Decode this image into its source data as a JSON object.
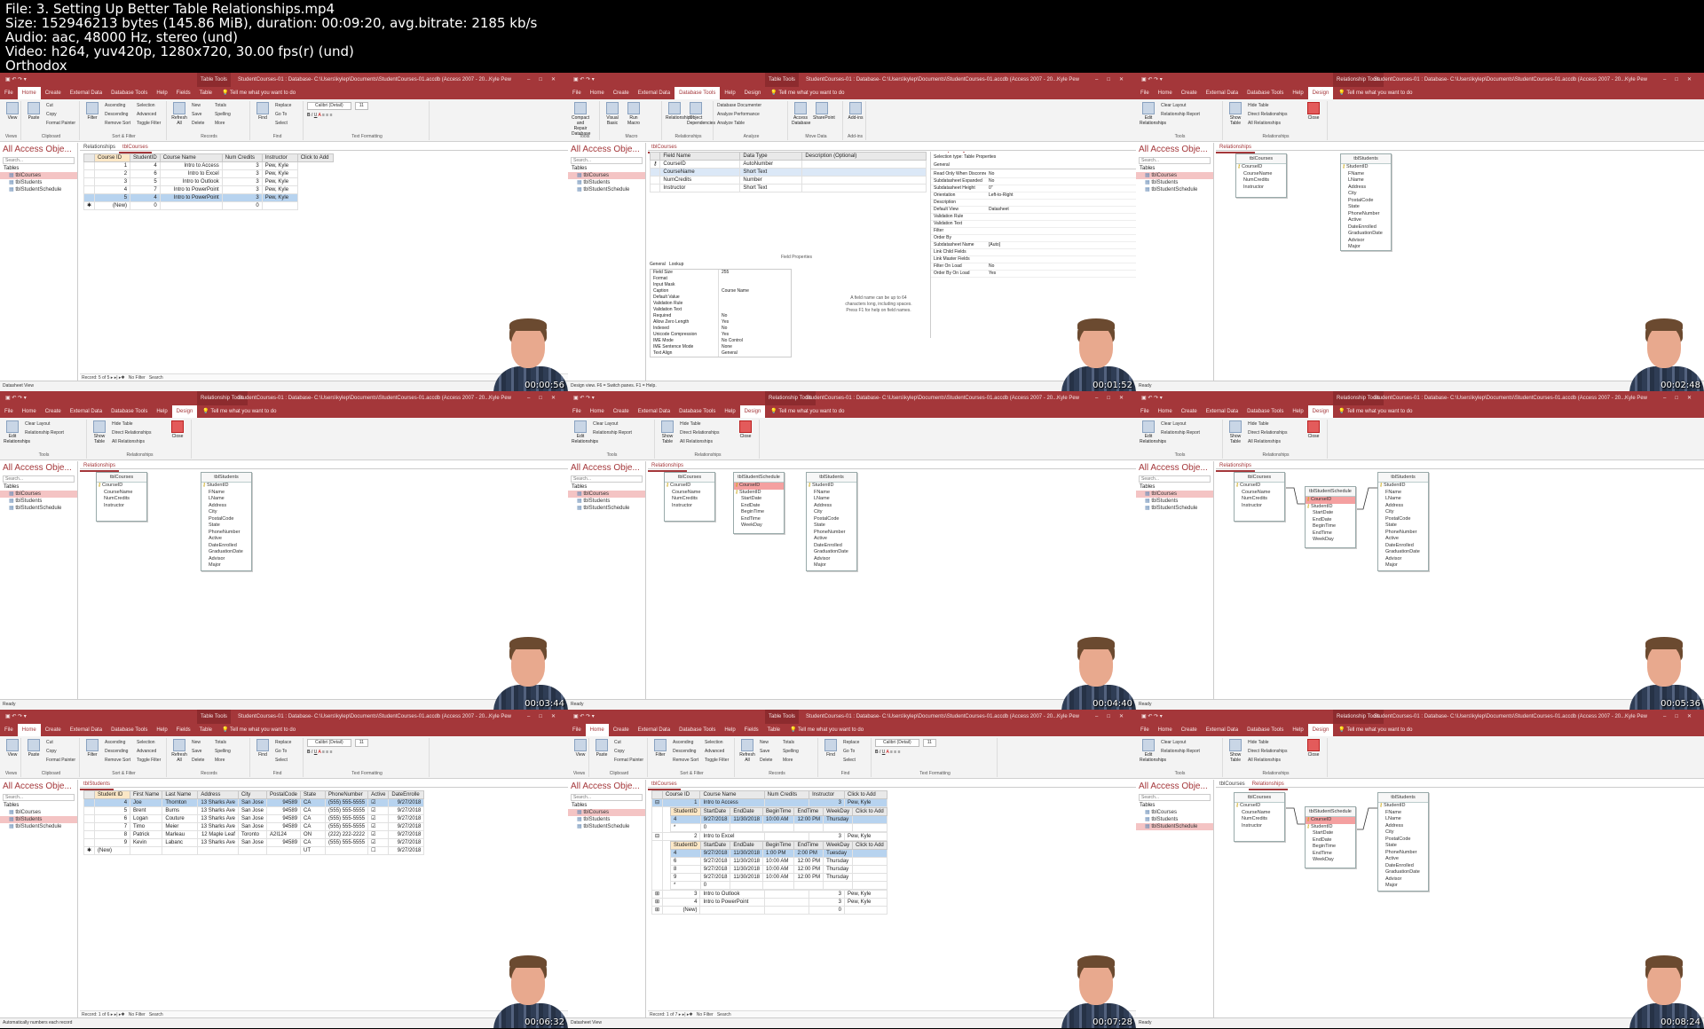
{
  "header": {
    "file": "File: 3. Setting Up Better Table Relationships.mp4",
    "size": "Size: 152946213 bytes (145.86 MiB), duration: 00:09:20, avg.bitrate: 2185 kb/s",
    "audio": "Audio: aac, 48000 Hz, stereo (und)",
    "video": "Video: h264, yuv420p, 1280x720, 30.00 fps(r) (und)",
    "brand": "Orthodox"
  },
  "common": {
    "file_tab": "File",
    "home_tab": "Home",
    "create_tab": "Create",
    "external_tab": "External Data",
    "dbtools_tab": "Database Tools",
    "help_tab": "Help",
    "fields_tab": "Fields",
    "table_tab": "Table",
    "design_tab": "Design",
    "tell_me": "Tell me what you want to do",
    "user": "Kyle Pew",
    "doc_title": "StudentCourses-01 : Database- C:\\Users\\kylep\\Documents\\StudentCourses-01.accdb (Access 2007 - 20...",
    "table_tools": "Table Tools",
    "rel_tools": "Relationship Tools",
    "nav_header": "All Access Obje...",
    "nav_search": "Search...",
    "nav_tables": "Tables",
    "t_courses": "tblCourses",
    "t_students": "tblStudents",
    "t_schedule": "tblStudentSchedule",
    "rel_tab": "Relationships",
    "status_ready": "Ready",
    "home_ribbon": {
      "views": "Views",
      "view": "View",
      "clipboard": "Clipboard",
      "paste": "Paste",
      "cut": "Cut",
      "copy": "Copy",
      "painter": "Format Painter",
      "sortfilter": "Sort & Filter",
      "filter": "Filter",
      "asc": "Ascending",
      "desc": "Descending",
      "remove": "Remove Sort",
      "selection": "Selection",
      "advanced": "Advanced",
      "toggle": "Toggle Filter",
      "records": "Records",
      "refresh": "Refresh All",
      "new": "New",
      "save": "Save",
      "delete": "Delete",
      "totals": "Totals",
      "spelling": "Spelling",
      "more": "More",
      "find_g": "Find",
      "find": "Find",
      "replace": "Replace",
      "goto": "Go To",
      "select": "Select",
      "textfmt": "Text Formatting",
      "font": "Calibri (Detail)",
      "fsize": "11"
    },
    "rel_ribbon": {
      "edit": "Edit Relationships",
      "clear": "Clear Layout",
      "report": "Relationship Report",
      "tools": "Tools",
      "show": "Show Table",
      "hide": "Hide Table",
      "direct": "Direct Relationships",
      "all": "All Relationships",
      "close": "Close",
      "relgroup": "Relationships"
    },
    "db_ribbon": {
      "compact": "Compact and Repair Database",
      "visual": "Visual Basic",
      "macro": "Run Macro",
      "rels": "Relationships",
      "objdep": "Object Dependencies",
      "documenter": "Database Documenter",
      "analyze_perf": "Analyze Performance",
      "analyze_table": "Analyze Table",
      "access": "Access Database",
      "sharepoint": "SharePoint",
      "addins": "Add-ins",
      "tools": "Tools",
      "macro_g": "Macro",
      "rel_g": "Relationships",
      "analyze": "Analyze",
      "move": "Move Data",
      "addins_g": "Add-ins"
    }
  },
  "courses_fields": [
    "CourseID",
    "CourseName",
    "NumCredits",
    "Instructor"
  ],
  "students_fields": [
    "StudentID",
    "FName",
    "LName",
    "Address",
    "City",
    "PostalCode",
    "State",
    "PhoneNumber",
    "Active",
    "DateEnrolled",
    "GraduationDate",
    "Advisor",
    "Major"
  ],
  "schedule_fields": [
    "CourseID",
    "StudentID",
    "StartDate",
    "EndDate",
    "BeginTime",
    "EndTime",
    "WeekDay"
  ],
  "frames": [
    {
      "ts": "00:00:56",
      "status": "Datasheet View",
      "cols": [
        "Course ID",
        "StudentID",
        "Course Name",
        "Num Credits",
        "Instructor",
        "Click to Add"
      ],
      "rows": [
        [
          "1",
          "4",
          "Intro to Access",
          "3",
          "Pew, Kyle"
        ],
        [
          "2",
          "6",
          "Intro to Excel",
          "3",
          "Pew, Kyle"
        ],
        [
          "3",
          "5",
          "Intro to Outlook",
          "3",
          "Pew, Kyle"
        ],
        [
          "4",
          "7",
          "Intro to PowerPoint",
          "3",
          "Pew, Kyle"
        ],
        [
          "5",
          "4",
          "Intro to PowerPoint",
          "3",
          "Pew, Kyle"
        ],
        [
          "(New)",
          "0",
          "",
          "0",
          ""
        ]
      ],
      "record": "Record: 5 of 5",
      "nofilter": "No Filter",
      "search": "Search"
    },
    {
      "ts": "00:01:52",
      "status": "Design view. F6 = Switch panes. F1 = Help.",
      "design_cols": [
        "Field Name",
        "Data Type",
        "Description (Optional)"
      ],
      "design_rows": [
        [
          "CourseID",
          "AutoNumber"
        ],
        [
          "CourseName",
          "Short Text"
        ],
        [
          "NumCredits",
          "Number"
        ],
        [
          "Instructor",
          "Short Text"
        ]
      ],
      "field_props": "Field Properties",
      "gen_tab": "General",
      "lookup_tab": "Lookup",
      "props": [
        [
          "Field Size",
          "255"
        ],
        [
          "Format",
          ""
        ],
        [
          "Input Mask",
          ""
        ],
        [
          "Caption",
          "Course Name"
        ],
        [
          "Default Value",
          ""
        ],
        [
          "Validation Rule",
          ""
        ],
        [
          "Validation Text",
          ""
        ],
        [
          "Required",
          "No"
        ],
        [
          "Allow Zero Length",
          "Yes"
        ],
        [
          "Indexed",
          "No"
        ],
        [
          "Unicode Compression",
          "Yes"
        ],
        [
          "IME Mode",
          "No Control"
        ],
        [
          "IME Sentence Mode",
          "None"
        ],
        [
          "Text Align",
          "General"
        ]
      ],
      "help": "A field name can be up to 64 characters long, including spaces. Press F1 for help on field names.",
      "ps_title": "Property Sheet",
      "ps_sel": "Selection type: Table Properties",
      "ps_gen": "General",
      "ps_rows": [
        [
          "Read Only When Disconnect",
          "No"
        ],
        [
          "Subdatasheet Expanded",
          "No"
        ],
        [
          "Subdatasheet Height",
          "0\""
        ],
        [
          "Orientation",
          "Left-to-Right"
        ],
        [
          "Description",
          ""
        ],
        [
          "Default View",
          "Datasheet"
        ],
        [
          "Validation Rule",
          ""
        ],
        [
          "Validation Text",
          ""
        ],
        [
          "Filter",
          ""
        ],
        [
          "Order By",
          ""
        ],
        [
          "Subdatasheet Name",
          "[Auto]"
        ],
        [
          "Link Child Fields",
          ""
        ],
        [
          "Link Master Fields",
          ""
        ],
        [
          "Filter On Load",
          "No"
        ],
        [
          "Order By On Load",
          "Yes"
        ]
      ]
    },
    {
      "ts": "00:02:48"
    },
    {
      "ts": "00:03:44"
    },
    {
      "ts": "00:04:40"
    },
    {
      "ts": "00:05:36"
    },
    {
      "ts": "00:06:32",
      "status": "Automatically numbers each record",
      "cols": [
        "Student ID",
        "First Name",
        "Last Name",
        "Address",
        "City",
        "PostalCode",
        "State",
        "PhoneNumber",
        "Active",
        "DateEnrolle"
      ],
      "rows": [
        [
          "4",
          "Joe",
          "Thornton",
          "13 Sharks Ave",
          "San Jose",
          "94589",
          "CA",
          "(555) 555-5555",
          "☑",
          "9/27/2018"
        ],
        [
          "5",
          "Brent",
          "Burns",
          "13 Sharks Ave",
          "San Jose",
          "94589",
          "CA",
          "(555) 555-5555",
          "☑",
          "9/27/2018"
        ],
        [
          "6",
          "Logan",
          "Couture",
          "13 Sharks Ave",
          "San Jose",
          "94589",
          "CA",
          "(555) 555-5555",
          "☑",
          "9/27/2018"
        ],
        [
          "7",
          "Timo",
          "Meier",
          "13 Sharks Ave",
          "San Jose",
          "94589",
          "CA",
          "(555) 555-5555",
          "☑",
          "9/27/2018"
        ],
        [
          "8",
          "Patrick",
          "Marleau",
          "12 Maple Leaf",
          "Toronto",
          "A2I124",
          "ON",
          "(222) 222-2222",
          "☑",
          "9/27/2018"
        ],
        [
          "9",
          "Kevin",
          "Labanc",
          "13 Sharks Ave",
          "San Jose",
          "94589",
          "CA",
          "(555) 555-5555",
          "☑",
          "9/27/2018"
        ],
        [
          "(New)",
          "",
          "",
          "",
          "",
          "",
          "UT",
          "",
          "☐",
          "9/27/2018"
        ]
      ],
      "record": "Record: 1 of 6",
      "nofilter": "No Filter",
      "search": "Search"
    },
    {
      "ts": "00:07:28",
      "status": "Datasheet View",
      "cols": [
        "Course ID",
        "Course Name",
        "Num Credits",
        "Instructor",
        "Click to Add"
      ],
      "sub_cols": [
        "StudentID",
        "StartDate",
        "EndDate",
        "BeginTime",
        "EndTime",
        "WeekDay",
        "Click to Add"
      ],
      "r1": [
        "1",
        "Intro to Access",
        "",
        "3",
        "Pew, Kyle"
      ],
      "s1": [
        [
          "4",
          "9/27/2018",
          "11/30/2018",
          "10:00 AM",
          "12:00 PM",
          "Thursday"
        ],
        [
          "*",
          "0",
          "",
          "",
          "",
          ""
        ]
      ],
      "r2": [
        "2",
        "Intro to Excel",
        "",
        "3",
        "Pew, Kyle"
      ],
      "s2": [
        [
          "4",
          "9/27/2018",
          "11/30/2018",
          "1:00 PM",
          "2:00 PM",
          "Tuesday"
        ],
        [
          "6",
          "9/27/2018",
          "11/30/2018",
          "10:00 AM",
          "12:00 PM",
          "Thursday"
        ],
        [
          "8",
          "9/27/2018",
          "11/30/2018",
          "10:00 AM",
          "12:00 PM",
          "Thursday"
        ],
        [
          "9",
          "9/27/2018",
          "11/30/2018",
          "10:00 AM",
          "12:00 PM",
          "Thursday"
        ],
        [
          "*",
          "0",
          "",
          "",
          "",
          ""
        ]
      ],
      "r3": [
        "3",
        "Intro to Outlook",
        "",
        "3",
        "Pew, Kyle"
      ],
      "r4": [
        "4",
        "Intro to PowerPoint",
        "",
        "3",
        "Pew, Kyle"
      ],
      "r5": [
        "(New)",
        "",
        "",
        "0",
        ""
      ],
      "record": "Record: 1 of 7",
      "nofilter": "No Filter",
      "search": "Search"
    },
    {
      "ts": "00:08:24"
    }
  ]
}
